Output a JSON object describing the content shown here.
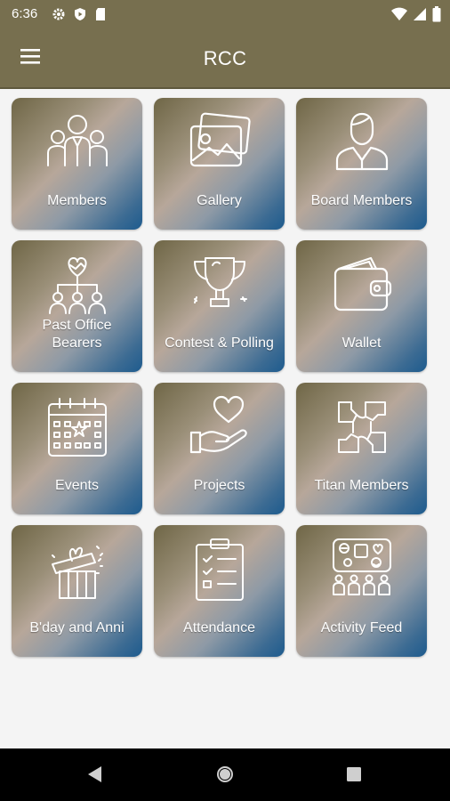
{
  "status_bar": {
    "time": "6:36"
  },
  "app_bar": {
    "title": "RCC"
  },
  "tiles": [
    {
      "label": "Members",
      "icon": "members-icon"
    },
    {
      "label": "Gallery",
      "icon": "gallery-icon"
    },
    {
      "label": "Board Members",
      "icon": "board-member-icon"
    },
    {
      "label_lines": [
        "Past Office",
        "Bearers"
      ],
      "icon": "past-office-bearers-icon"
    },
    {
      "label": "Contest & Polling",
      "icon": "trophy-icon"
    },
    {
      "label": "Wallet",
      "icon": "wallet-icon"
    },
    {
      "label": "Events",
      "icon": "calendar-icon"
    },
    {
      "label": "Projects",
      "icon": "heart-hand-icon"
    },
    {
      "label": "Titan Members",
      "icon": "hands-circle-icon"
    },
    {
      "label": "B'day and Anni",
      "icon": "gift-icon"
    },
    {
      "label": "Attendance",
      "icon": "clipboard-checklist-icon"
    },
    {
      "label": "Activity Feed",
      "icon": "activity-feed-icon"
    }
  ],
  "colors": {
    "app_bar": "#776f4f",
    "tile_gradient_start": "#6f6646",
    "tile_gradient_end": "#1d5b8e",
    "background": "#f4f4f4"
  }
}
